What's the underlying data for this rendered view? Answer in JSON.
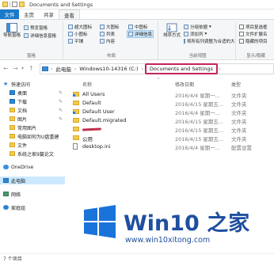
{
  "window": {
    "title": "Documents and Settings"
  },
  "tabs": {
    "file": "文件",
    "home": "主页",
    "share": "共享",
    "view": "查看"
  },
  "ribbon": {
    "panes": {
      "nav_pane": "导航窗格",
      "preview_pane": "预览窗格",
      "details_pane": "详细信息窗格",
      "group_label": "窗格"
    },
    "layout": {
      "xl_icons": "超大图标",
      "l_icons": "大图标",
      "m_icons": "中图标",
      "s_icons": "小图标",
      "list": "列表",
      "details": "详细信息",
      "tiles": "平铺",
      "content": "内容",
      "group_label": "布局"
    },
    "current_view": {
      "sort": "排序方式",
      "group_by": "分组依据",
      "add_cols": "添加列",
      "fit_cols": "将所有列调整为合适的大小",
      "group_label": "当前视图"
    },
    "show_hide": {
      "item_checkboxes": "项目复选框",
      "file_ext": "文件扩展名",
      "hidden_items": "隐藏的项目",
      "group_label": "显示/隐藏"
    }
  },
  "address": {
    "crumbs": [
      "此电脑",
      "Windows10-14316 (C:)",
      "Documents and Settings"
    ]
  },
  "nav": {
    "items": [
      {
        "label": "快速访问",
        "icon": "star-icon"
      },
      {
        "label": "桌面",
        "icon": "desktop-icon",
        "pinned": true
      },
      {
        "label": "下载",
        "icon": "download-icon",
        "pinned": true
      },
      {
        "label": "文档",
        "icon": "documents-icon",
        "pinned": true
      },
      {
        "label": "图片",
        "icon": "pictures-icon",
        "pinned": true
      },
      {
        "label": "常用图片",
        "icon": "folder-icon"
      },
      {
        "label": "电脑如何为U盘重建",
        "icon": "folder-icon"
      },
      {
        "label": "文件",
        "icon": "folder-icon"
      },
      {
        "label": "系统之家9篇论文",
        "icon": "folder-icon"
      },
      {
        "label": "OneDrive",
        "icon": "onedrive-icon"
      },
      {
        "label": "此电脑",
        "icon": "pc-icon"
      },
      {
        "label": "网络",
        "icon": "network-icon"
      },
      {
        "label": "家庭组",
        "icon": "homegroup-icon"
      }
    ]
  },
  "columns": {
    "name": "名称",
    "date": "修改日期",
    "type": "类型"
  },
  "files": [
    {
      "name": "All Users",
      "date": "2016/4/4 星期一...",
      "type": "文件夹",
      "icon": "folder-link"
    },
    {
      "name": "Default",
      "date": "2016/4/15 星期五...",
      "type": "文件夹",
      "icon": "folder"
    },
    {
      "name": "Default User",
      "date": "2016/4/4 星期一...",
      "type": "文件夹",
      "icon": "folder-link"
    },
    {
      "name": "Default.migrated",
      "date": "2016/4/15 星期五...",
      "type": "文件夹",
      "icon": "folder"
    },
    {
      "name": "",
      "date": "2016/4/15 星期五...",
      "type": "文件夹",
      "icon": "folder",
      "redacted": true
    },
    {
      "name": "公用",
      "date": "2016/4/15 星期五...",
      "type": "文件夹",
      "icon": "folder"
    },
    {
      "name": "desktop.ini",
      "date": "2016/4/4 星期一...",
      "type": "配置设置",
      "icon": "file"
    }
  ],
  "status": {
    "item_count": "7 个项目"
  },
  "watermark": {
    "title": "Win10 之家",
    "url": "www.win10xitong.com"
  }
}
